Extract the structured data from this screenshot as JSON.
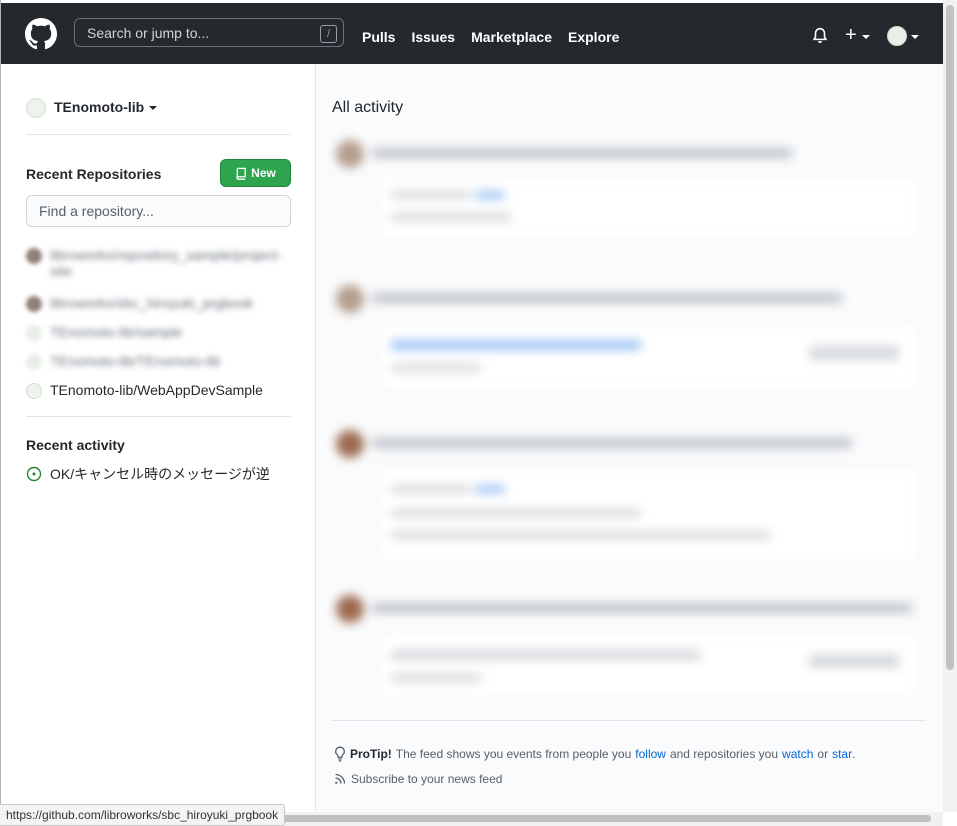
{
  "header": {
    "search_placeholder": "Search or jump to...",
    "slash_key": "/",
    "nav": [
      "Pulls",
      "Issues",
      "Marketplace",
      "Explore"
    ]
  },
  "sidebar": {
    "user": "TEnomoto-lib",
    "recent_repositories_title": "Recent Repositories",
    "new_button": "New",
    "find_placeholder": "Find a repository...",
    "repositories": [
      "libroworks/repository_sample/project-site",
      "libroworks/sbc_hiroyuki_prgbook",
      "TEnomoto-lib/sample",
      "TEnomoto-lib/TEnomoto-lib",
      "TEnomoto-lib/WebAppDevSample"
    ],
    "recent_activity_title": "Recent activity",
    "activity_item": "OK/キャンセル時のメッセージが逆"
  },
  "main": {
    "title": "All activity",
    "protip_label": "ProTip!",
    "protip_text_1": "The feed shows you events from people you",
    "protip_follow": "follow",
    "protip_text_2": "and repositories you",
    "protip_watch": "watch",
    "protip_or": "or",
    "protip_star": "star",
    "protip_end": ".",
    "subscribe": "Subscribe to your news feed"
  },
  "status_url": "https://github.com/libroworks/sbc_hiroyuki_prgbook",
  "colors": {
    "header_bg": "#24292e",
    "new_button": "#2ea44f",
    "link": "#0366d6",
    "issue_open": "#22863a"
  }
}
